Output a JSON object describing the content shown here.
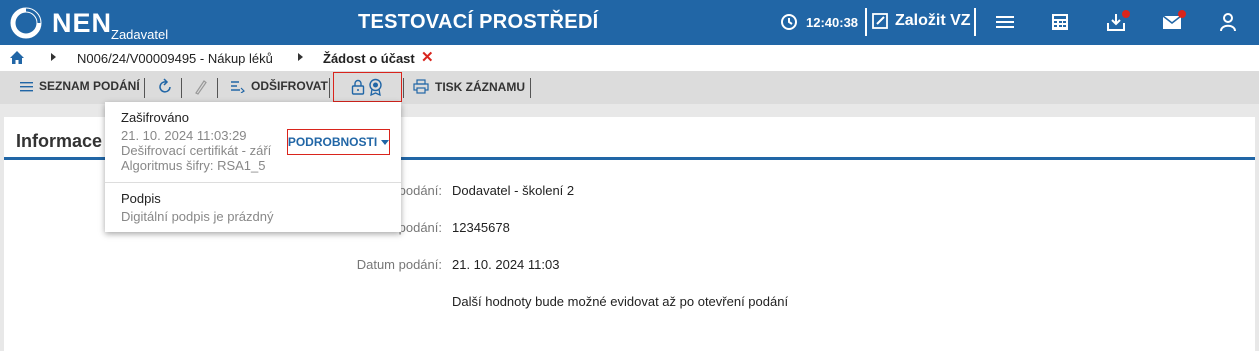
{
  "header": {
    "logo_text": "NEN",
    "logo_sub": "Zadavatel",
    "environment_title": "TESTOVACÍ PROSTŘEDÍ",
    "clock": "12:40:38",
    "new_vz_label": "Založit VZ",
    "icons": [
      "clock-icon",
      "edit-icon",
      "menu-icon",
      "calculator-icon",
      "inbox-download-icon",
      "mail-icon",
      "user-icon"
    ],
    "badge_color": "#d9241c",
    "brand_color": "#2166a6"
  },
  "breadcrumb": {
    "items": [
      "N006/24/V00009495 - Nákup léků",
      "Žádost o účast"
    ],
    "close_symbol": "✕"
  },
  "toolbar": {
    "list_label": "SEZNAM PODÁNÍ",
    "decrypt_label": "ODŠIFROVAT",
    "print_label": "TISK ZÁZNAMU"
  },
  "panel": {
    "title": "Informace",
    "rows": [
      {
        "label": "podání:",
        "value": "Dodavatel - školení 2"
      },
      {
        "label": "podání:",
        "value": "12345678"
      },
      {
        "label": "Datum podání:",
        "value": "21. 10. 2024 11:03"
      }
    ],
    "note": "Další hodnoty bude možné evidovat až po otevření podání"
  },
  "popup": {
    "encrypted_title": "Zašifrováno",
    "encrypted_date": "21. 10. 2024 11:03:29",
    "encrypted_cert": "Dešifrovací certifikát - září",
    "encrypted_algo": "Algoritmus šifry: RSA1_5",
    "details_button": "PODROBNOSTI",
    "signature_title": "Podpis",
    "signature_status": "Digitální podpis je prázdný"
  }
}
